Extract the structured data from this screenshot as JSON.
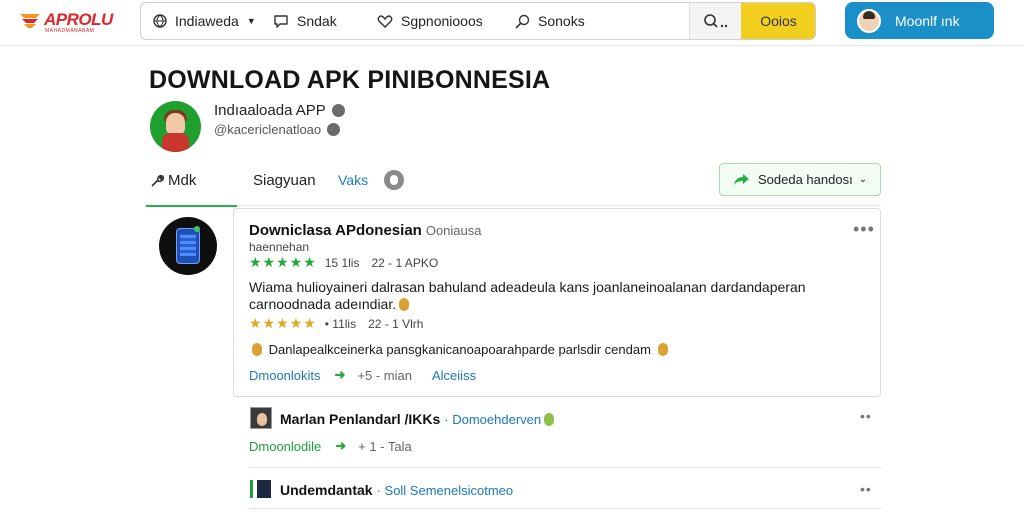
{
  "header": {
    "logo_text": "APROLU",
    "logo_sub": "MAHADMANABAM",
    "nav": [
      {
        "label": "Indiaweda",
        "icon": "globe-icon"
      },
      {
        "label": "Sndak",
        "icon": "chat-icon"
      },
      {
        "label": "Sgpnoniooos",
        "icon": "heart-icon"
      },
      {
        "label": "Sonoks",
        "icon": "search-icon"
      }
    ],
    "yellow_label": "Ooios",
    "login_label": "Moonlf ınk"
  },
  "page": {
    "title": "DOWNLOAD APK PINIBONNESIA",
    "profile_name": "Indıaaloada APP",
    "profile_handle": "@kacericlenatloao"
  },
  "tabs": {
    "items": [
      "Mdk",
      "Siagyuan",
      "Vaks"
    ],
    "filter_label": "Sodeda handosı"
  },
  "post": {
    "title": "Downiclasa APdonesian",
    "title_muted": "Ooniausa",
    "subtitle": "haennehan",
    "rating_1": {
      "stars": "★★★★★",
      "meta_a": "15 1lis",
      "meta_b": "22 - 1 APKO"
    },
    "description": "Wiama hulioyaineri dalrasan bahuland adeadeula kans joanlaneinoalanan dardandaperan carnoodnada adeındiar.",
    "rating_2": {
      "stars": "★★★★★",
      "meta_a": "• 11lis",
      "meta_b": "22 - 1 Vlrh"
    },
    "note": "Danlapealkceinerka pansgkanicanoapoarahparde parlsdir cendam",
    "action_link": "Dmoonlokits",
    "action_meta": "+5 - mian",
    "action_link2": "Alceiiss"
  },
  "replies": [
    {
      "name": "Marlan Penlandarl /IKKs",
      "meta": "· Domoehderven",
      "action_link": "Dmoonlodile",
      "action_meta": "+ 1 - Tala"
    },
    {
      "name": "Undemdantak",
      "meta": "· Soll Semenelsicotmeo"
    }
  ],
  "colors": {
    "brand_red": "#e0262b",
    "accent_green": "#2ab04a",
    "link_blue": "#1b78b8",
    "login_blue": "#1a8fc8",
    "yellow": "#f2cf1f",
    "star_green": "#24a83e",
    "star_gold": "#e0a820"
  }
}
